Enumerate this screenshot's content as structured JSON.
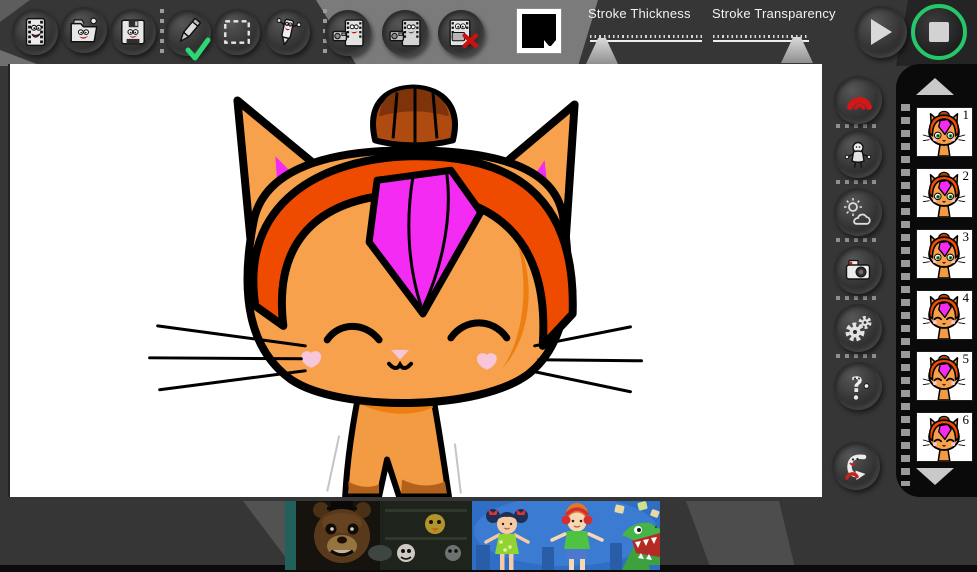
{
  "app": {
    "title": "Kids animation drawing studio"
  },
  "toolbar": {
    "file_buttons": [
      {
        "name": "movie-project"
      },
      {
        "name": "open-project"
      },
      {
        "name": "save-project"
      }
    ],
    "tool_buttons": [
      {
        "name": "pen-tool",
        "active": true,
        "active_check_color": "#2bd873"
      },
      {
        "name": "select-tool"
      },
      {
        "name": "eraser-tool"
      }
    ],
    "frame_buttons": [
      {
        "name": "capture-frame"
      },
      {
        "name": "duplicate-frame"
      },
      {
        "name": "delete-frame",
        "badge_color": "#cc1111"
      }
    ],
    "color_swatch": {
      "selected_color": "#000000"
    },
    "sliders": [
      {
        "label": "Stroke Thickness",
        "position": "low"
      },
      {
        "label": "Stroke Transparency",
        "position": "high"
      }
    ],
    "playback": {
      "play": "play",
      "stop": "stop",
      "stop_active": true,
      "active_ring_color": "#25c768"
    }
  },
  "sidebar": {
    "buttons": [
      {
        "name": "stroke-color"
      },
      {
        "name": "character"
      },
      {
        "name": "scene-weather"
      },
      {
        "name": "camera"
      },
      {
        "name": "settings"
      },
      {
        "name": "help"
      },
      {
        "name": "undo"
      }
    ]
  },
  "filmstrip": {
    "scroll_up": "up",
    "scroll_down": "down",
    "frames": [
      {
        "number": "1",
        "thumbnail": "orange-cat-open-eyes"
      },
      {
        "number": "2",
        "thumbnail": "orange-cat-open-eyes"
      },
      {
        "number": "3",
        "thumbnail": "orange-cat-open-eyes"
      },
      {
        "number": "4",
        "thumbnail": "orange-cat-closed-eyes"
      },
      {
        "number": "5",
        "thumbnail": "orange-cat-closed-eyes"
      },
      {
        "number": "6",
        "thumbnail": "orange-cat-closed-eyes"
      }
    ]
  },
  "canvas": {
    "description": "Hand drawing of an orange cat wearing an orange hood with a magenta bang, pink inner ears, closed happy eyes, whiskers and a small body",
    "palette": {
      "body": "#f7a14c",
      "hood": "#ee4a00",
      "bang": "#f32bf3",
      "topknot": "#a8490f",
      "cheeks": "#f8c6da",
      "outline": "#000000"
    }
  },
  "ads": {
    "left": {
      "name": "fnaf-game-ad"
    },
    "right": {
      "name": "kids-cartoon-dino-ad"
    }
  }
}
